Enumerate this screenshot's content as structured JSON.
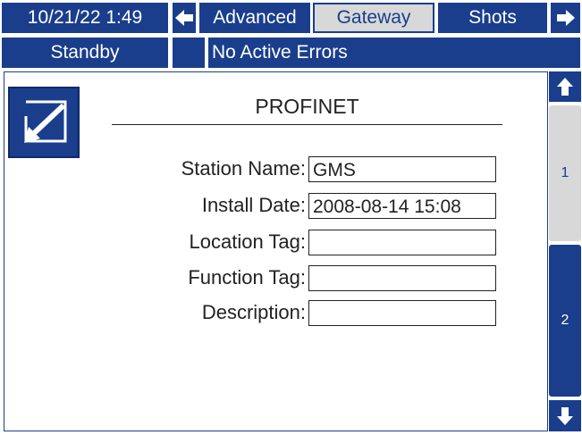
{
  "header": {
    "datetime": "10/21/22 1:49",
    "tabs": [
      {
        "label": "Advanced",
        "active": false
      },
      {
        "label": "Gateway",
        "active": true
      },
      {
        "label": "Shots",
        "active": false
      }
    ],
    "status": "Standby",
    "errors": "No Active Errors"
  },
  "screen": {
    "title": "PROFINET",
    "fields": [
      {
        "label": "Station Name:",
        "value": "GMS"
      },
      {
        "label": "Install Date:",
        "value": "2008-08-14 15:08"
      },
      {
        "label": "Location Tag:",
        "value": ""
      },
      {
        "label": "Function Tag:",
        "value": ""
      },
      {
        "label": "Description:",
        "value": ""
      }
    ]
  },
  "pages": {
    "items": [
      {
        "label": "1",
        "active": true
      },
      {
        "label": "2",
        "active": false
      }
    ]
  },
  "colors": {
    "primary": "#1a3e8c",
    "inactive_tab": "#d8d8d8",
    "text": "#222222"
  },
  "icons": {
    "prev_screen": "arrow-left-icon",
    "next_screen": "arrow-right-icon",
    "edit": "edit-icon",
    "scroll_up": "arrow-up-icon",
    "scroll_down": "arrow-down-icon"
  }
}
